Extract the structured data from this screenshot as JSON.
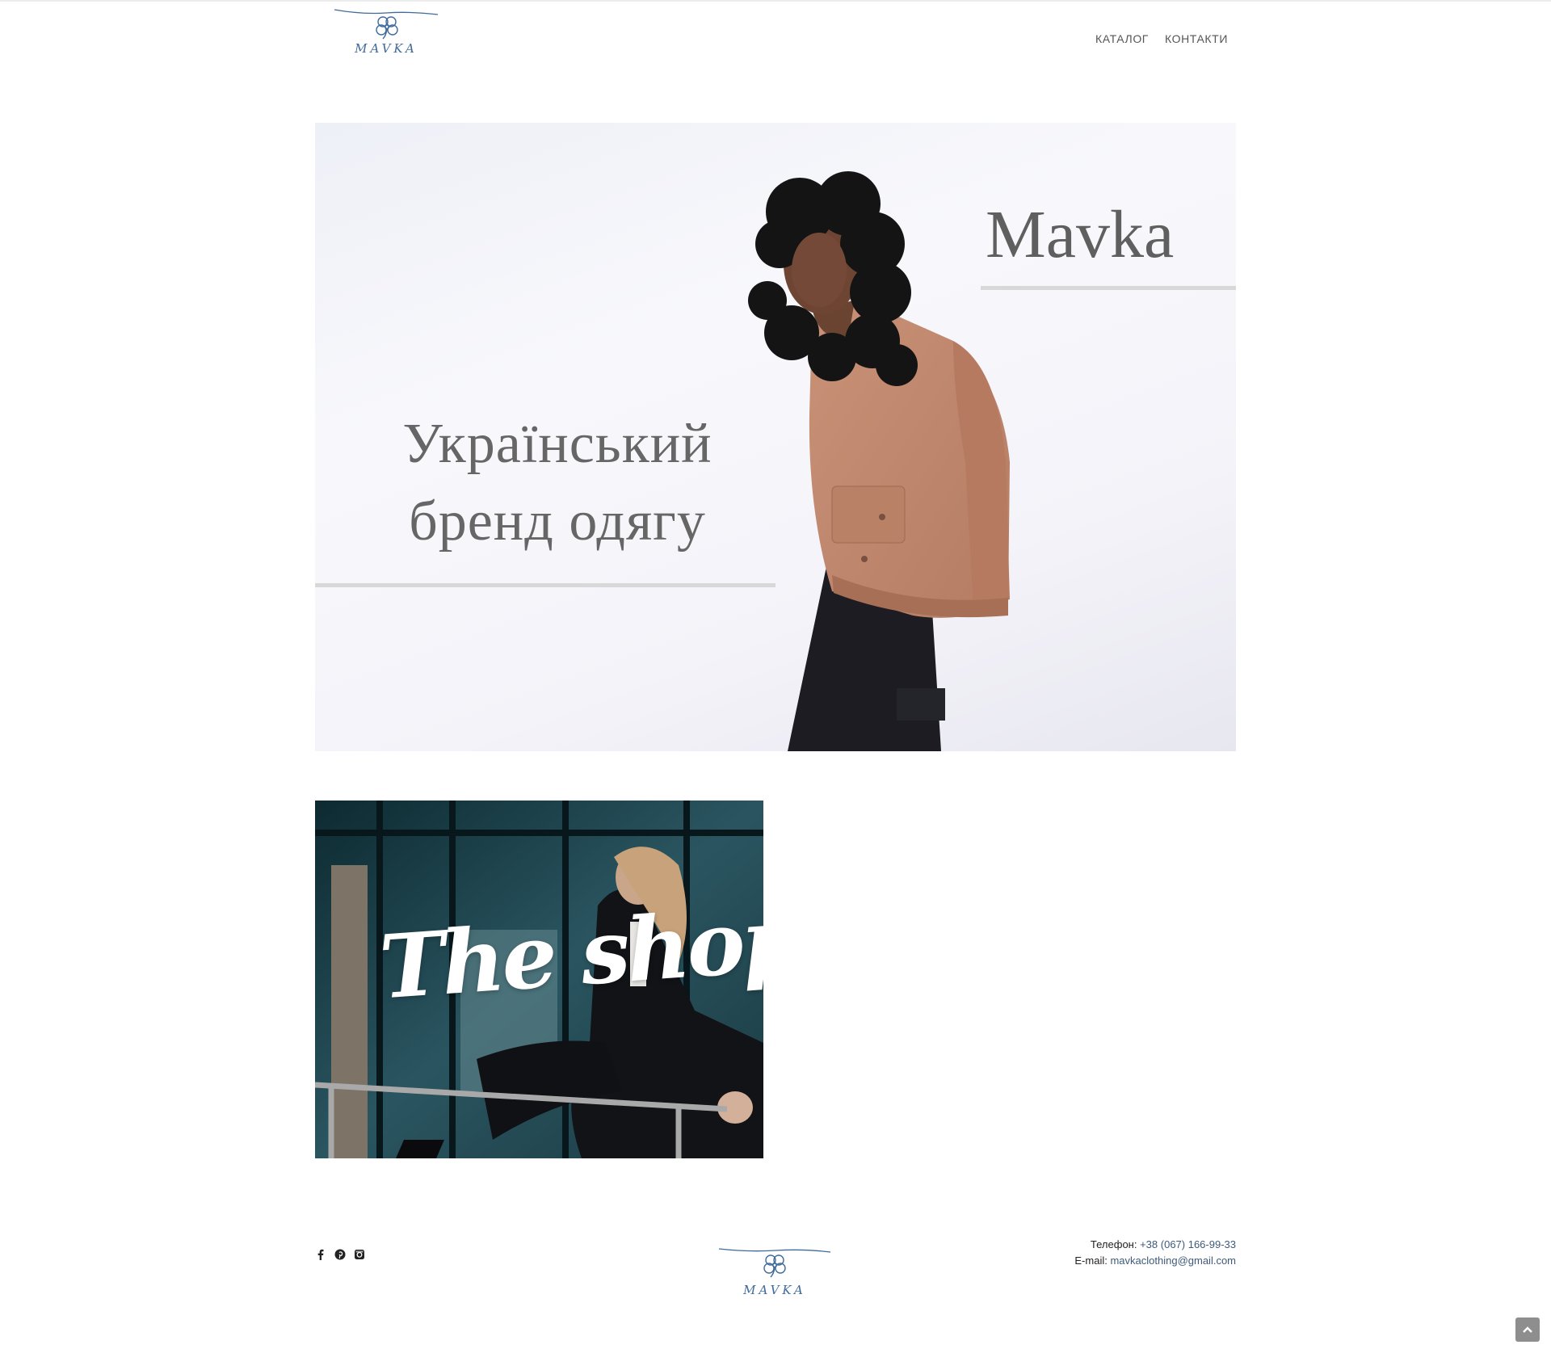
{
  "brand": {
    "logo_text": "MAVKA"
  },
  "nav": {
    "items": [
      {
        "label": "КАТАЛОГ"
      },
      {
        "label": "КОНТАКТИ"
      }
    ]
  },
  "hero": {
    "brand_title": "Mavka",
    "tagline_line1": "Український",
    "tagline_line2": "бренд одягу"
  },
  "shop": {
    "title": "The shop"
  },
  "footer": {
    "phone_label": "Телефон:",
    "phone": "+38 (067) 166-99-33",
    "email_label": "E-mail:",
    "email": "mavkaclothing@gmail.com",
    "social_icons": [
      "facebook-icon",
      "pinterest-icon",
      "instagram-icon"
    ]
  },
  "colors": {
    "logo_blue": "#3f6a9b",
    "link": "#3e5a7a",
    "heading_grey": "#5f5f5f"
  }
}
